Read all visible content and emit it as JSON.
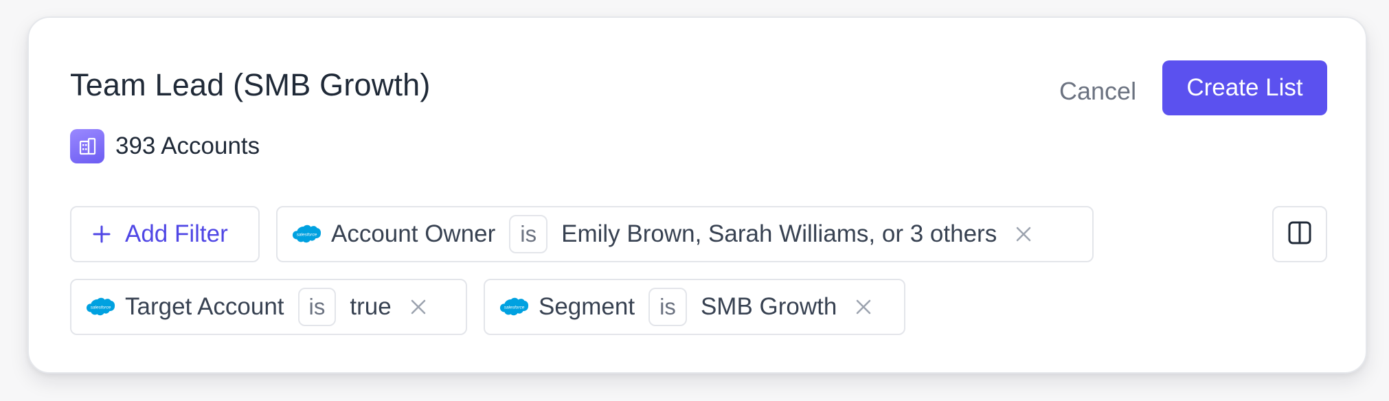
{
  "header": {
    "title": "Team Lead (SMB Growth)",
    "cancel_label": "Cancel",
    "create_label": "Create List"
  },
  "summary": {
    "count_text": "393 Accounts",
    "icon": "building-icon"
  },
  "toolbar": {
    "add_filter_label": "Add Filter",
    "panel_toggle_icon": "split-panel-icon"
  },
  "filters": [
    {
      "source_icon": "salesforce-icon",
      "field": "Account Owner",
      "operator": "is",
      "value": "Emily Brown, Sarah Williams, or 3 others"
    },
    {
      "source_icon": "salesforce-icon",
      "field": "Target Account",
      "operator": "is",
      "value": "true"
    },
    {
      "source_icon": "salesforce-icon",
      "field": "Segment",
      "operator": "is",
      "value": "SMB Growth"
    }
  ],
  "colors": {
    "accent": "#5b51ef",
    "accent_text": "#4f46e5",
    "salesforce_blue": "#00a1e0"
  }
}
